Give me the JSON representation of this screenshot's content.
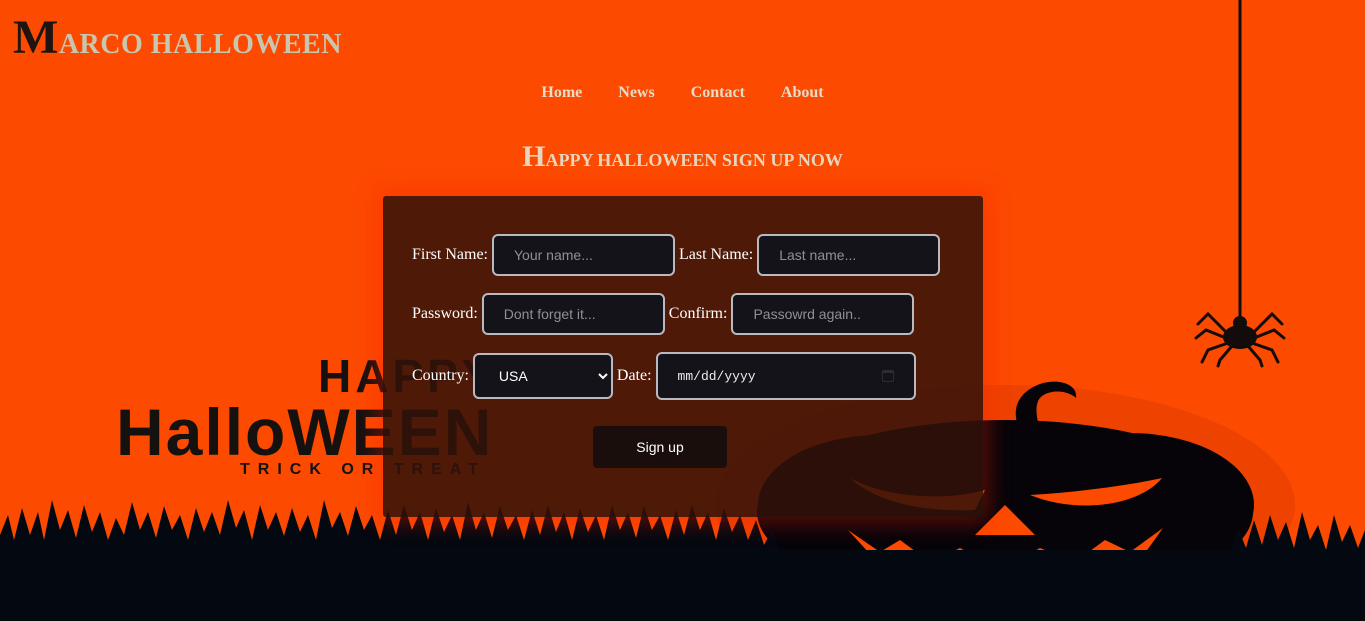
{
  "site": {
    "title_initial": "M",
    "title_rest": "arco halloween"
  },
  "nav": {
    "items": [
      "Home",
      "News",
      "Contact",
      "About"
    ]
  },
  "heading": {
    "initial": "H",
    "rest": "appy halloween sign up now"
  },
  "form": {
    "first_name_label": "First Name:",
    "first_name_placeholder": "Your name...",
    "last_name_label": "Last Name:",
    "last_name_placeholder": "Last name...",
    "password_label": "Password:",
    "password_placeholder": "Dont forget it...",
    "confirm_label": "Confirm:",
    "confirm_placeholder": "Passowrd again..",
    "country_label": "Country:",
    "country_value": "USA",
    "date_label": "Date:",
    "date_placeholder": "mm/dd/yyyy",
    "submit_label": "Sign up"
  },
  "background_art": {
    "happy_text": "HAPPY",
    "halloween_text": "HalloWEEN",
    "tagline_text": "TRICK OR TREAT"
  },
  "colors": {
    "background": "#fc4a00",
    "ground": "#040810",
    "card": "#3a1508",
    "title_color": "#c9c6b0",
    "nav_color": "#e8dcc7"
  }
}
